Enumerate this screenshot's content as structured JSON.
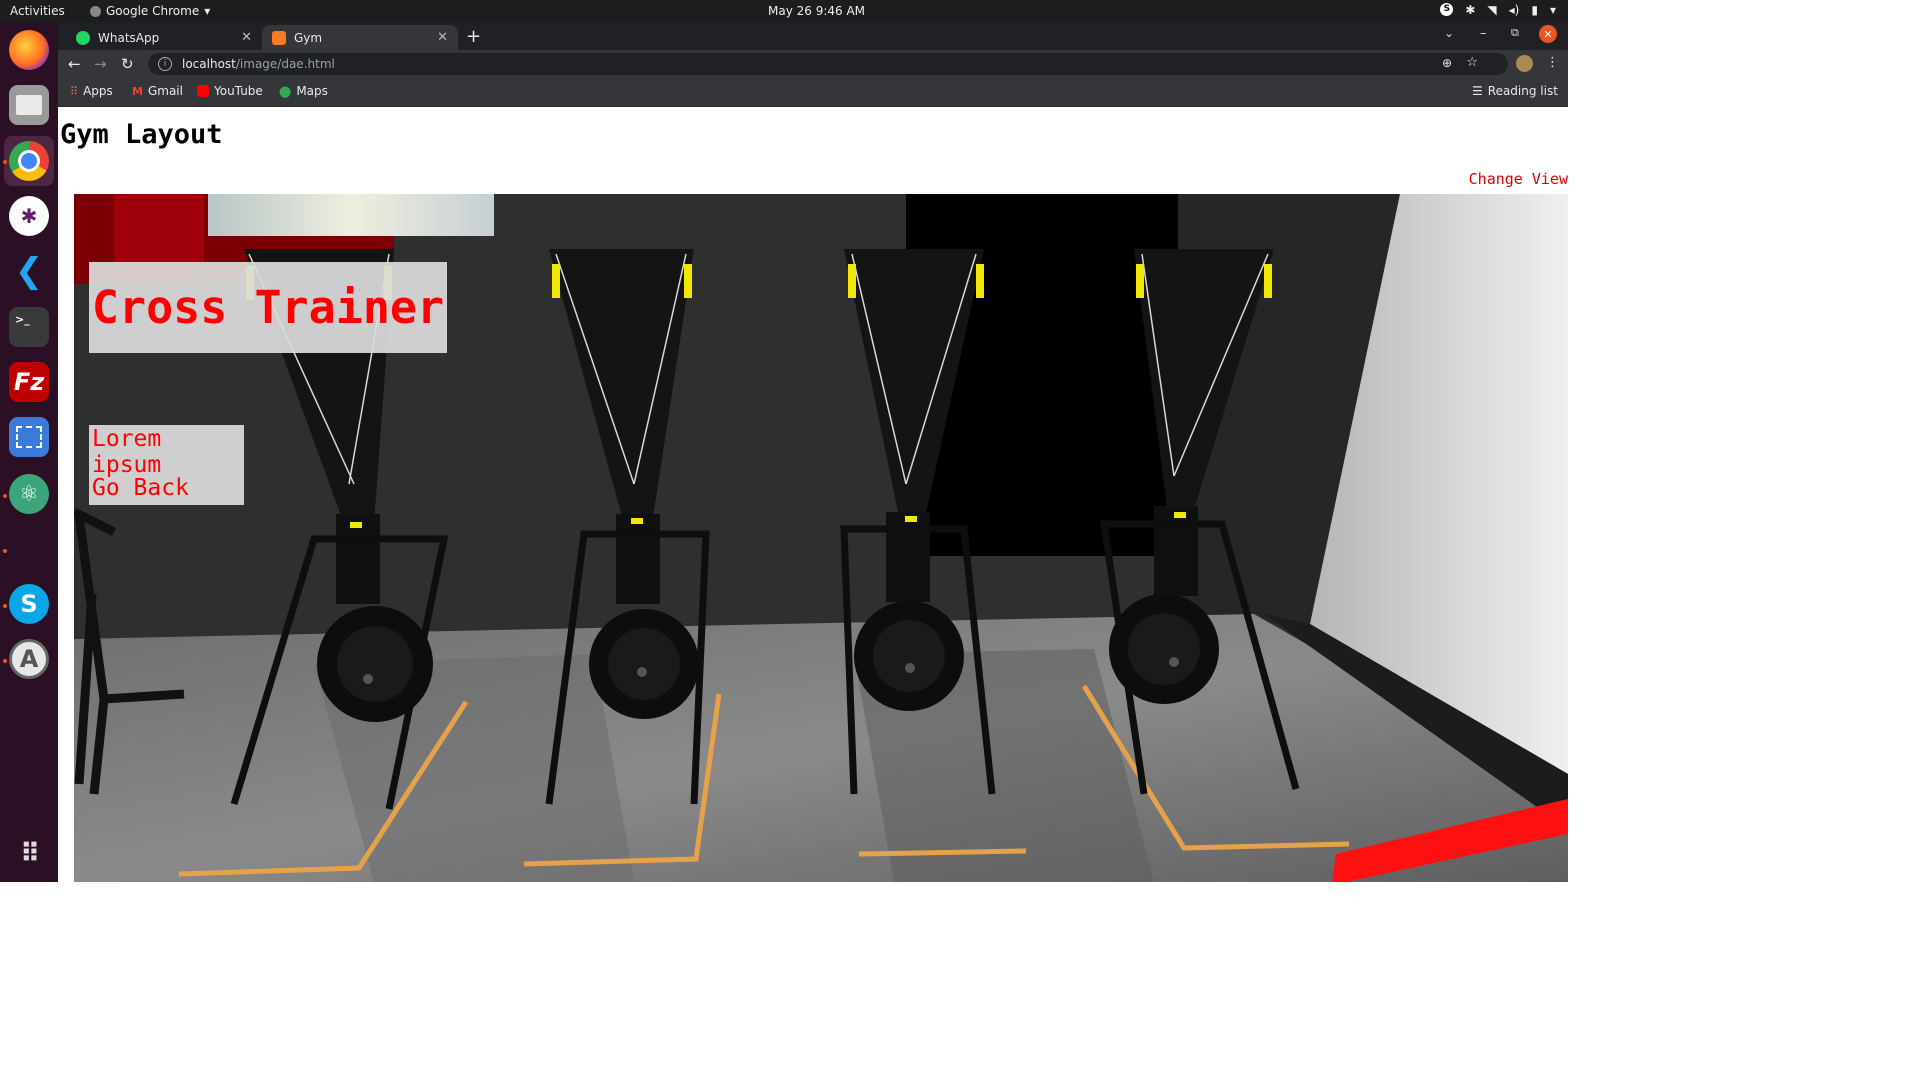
{
  "system": {
    "activities": "Activities",
    "app_name": "Google Chrome",
    "clock": "May 26  9:46 AM"
  },
  "browser": {
    "tabs": [
      {
        "label": "WhatsApp",
        "icon": "whatsapp-icon",
        "active": false
      },
      {
        "label": "Gym",
        "icon": "xampp-icon",
        "active": true
      }
    ],
    "address": {
      "host": "localhost",
      "path": "/image/dae.html"
    },
    "bookmarks": [
      "Apps",
      "Gmail",
      "YouTube",
      "Maps"
    ],
    "reading_list": "Reading list"
  },
  "page": {
    "title": "Gym Layout",
    "change_view": "Change View",
    "overlay_title": "Cross Trainer",
    "menu": {
      "item1": "Lorem ipsum",
      "item2": "Go Back"
    }
  },
  "colors": {
    "accent_red": "#ff0000",
    "dock_bg": "#2b0f24",
    "browser_dark": "#35363a"
  }
}
